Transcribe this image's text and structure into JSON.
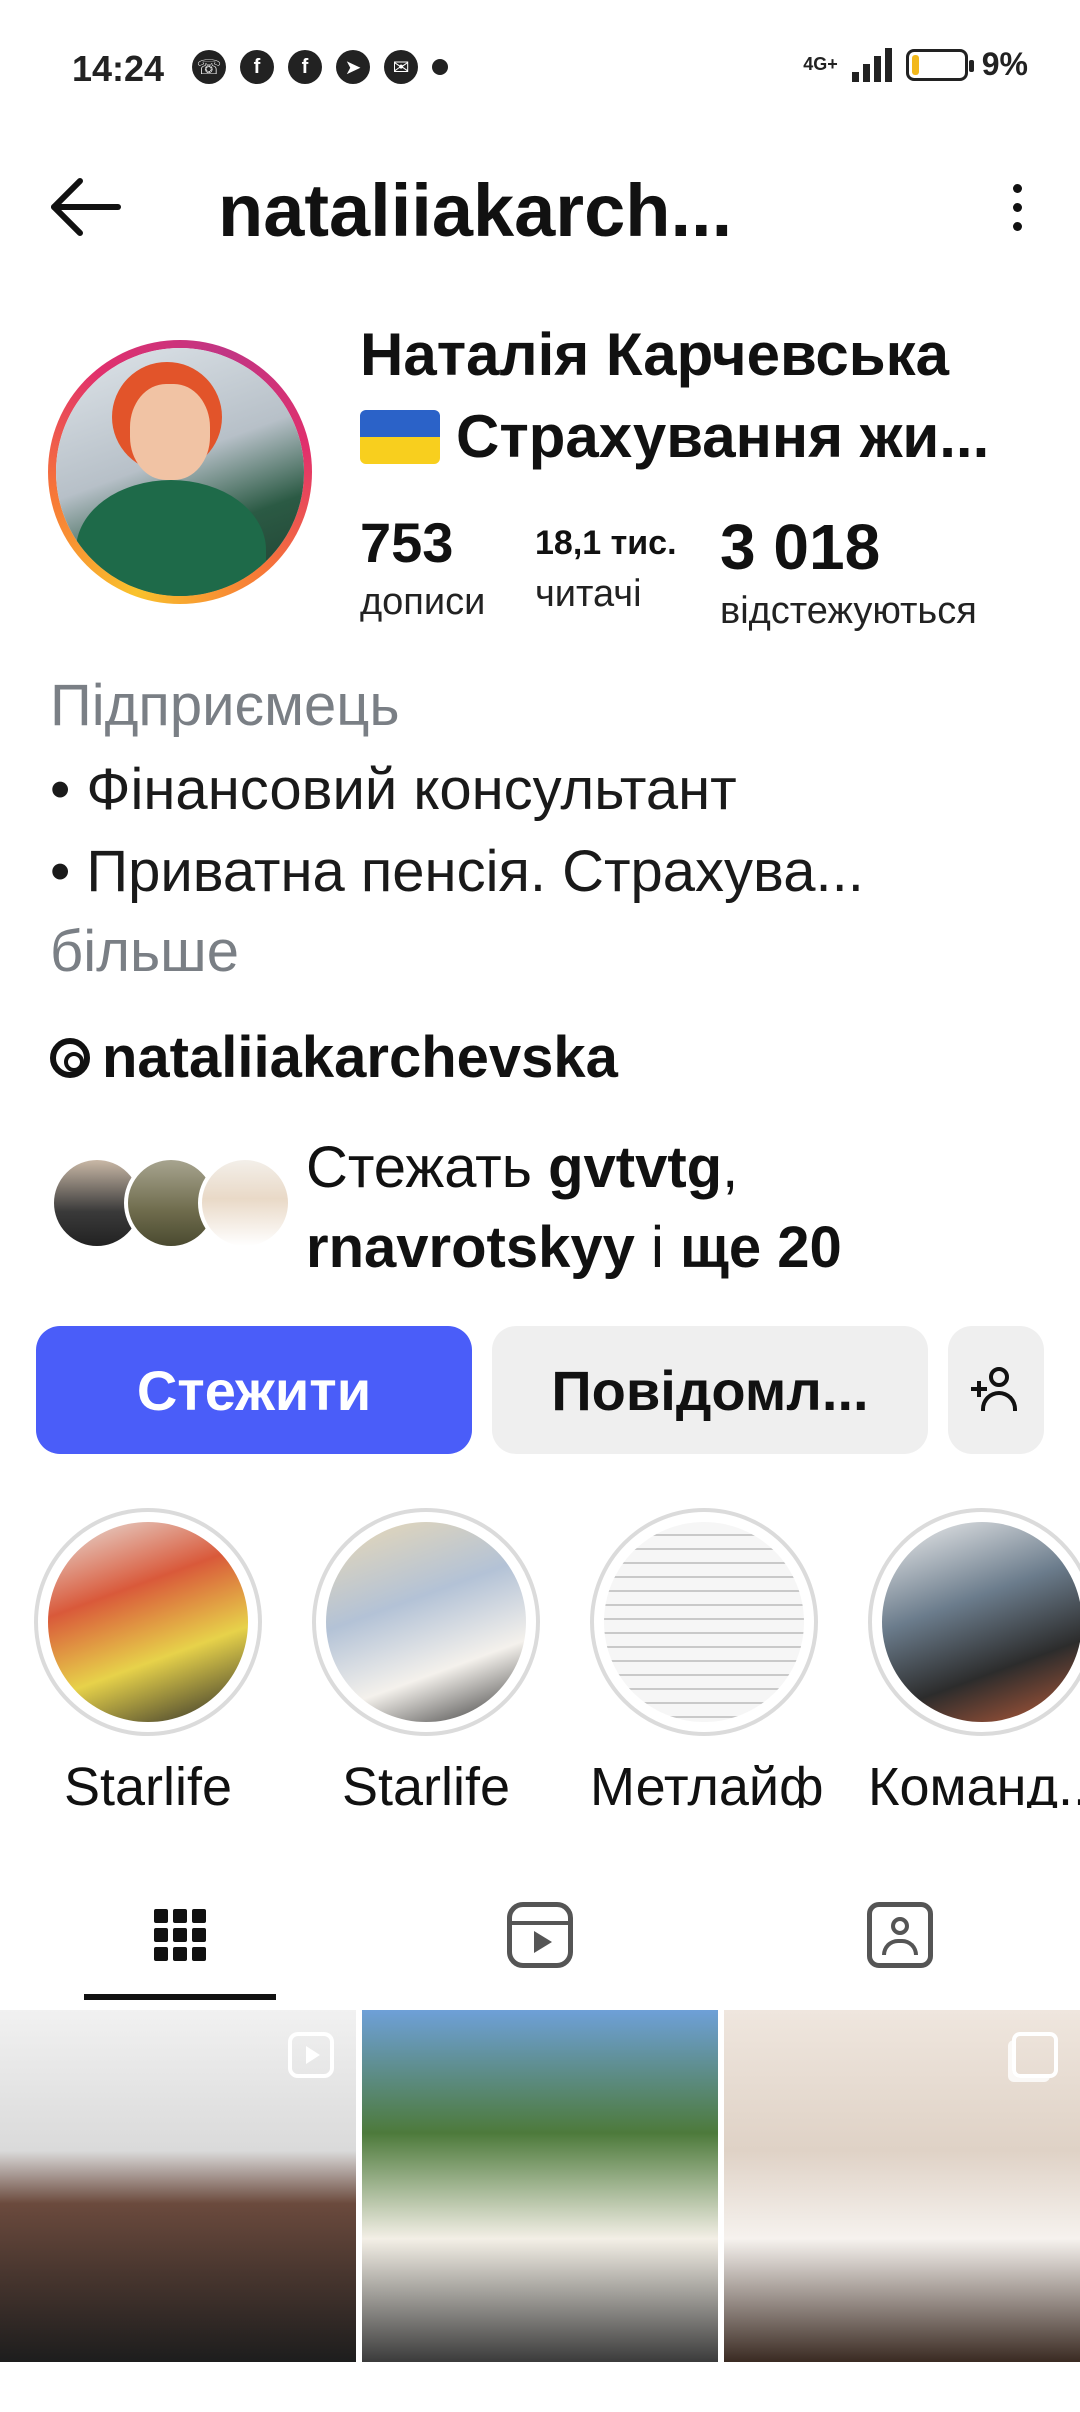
{
  "status_bar": {
    "time": "14:24",
    "network": "4G+",
    "battery_percent_label": "9%",
    "battery_level": 0.09,
    "notification_icons": [
      "viber-icon",
      "facebook-icon",
      "facebook-icon",
      "telegram-icon",
      "mail-icon",
      "dot-icon"
    ]
  },
  "header": {
    "title": "nataliiakarch..."
  },
  "profile": {
    "display_name": "Наталія Карчевська",
    "subtitle": "Страхування жи...",
    "stats": {
      "posts_count": "753",
      "posts_label": "дописи",
      "followers_count": "18,1 тис.",
      "followers_label": "читачі",
      "following_count": "3 018",
      "following_label": "відстежуються"
    }
  },
  "bio": {
    "category": "Підприємець",
    "line1": "• Фінансовий консультант",
    "line2": "• Приватна пенсія. Страхува...",
    "more": "більше",
    "threads_handle": "nataliiakarchevska"
  },
  "followed_by": {
    "prefix": "Стежать ",
    "user1": "gvtvtg",
    "separator": ",",
    "user2": "rnavrotskyy",
    "and": " і ",
    "more": "ще 20"
  },
  "actions": {
    "follow_label": "Стежити",
    "message_label": "Повідомл..."
  },
  "highlights": [
    {
      "label": "Starlife"
    },
    {
      "label": "Starlife"
    },
    {
      "label": "Метлайф"
    },
    {
      "label": "Команд..."
    }
  ],
  "colors": {
    "accent": "#4a5df9",
    "secondary_button": "#efefef",
    "muted_text": "#7a7f85"
  }
}
